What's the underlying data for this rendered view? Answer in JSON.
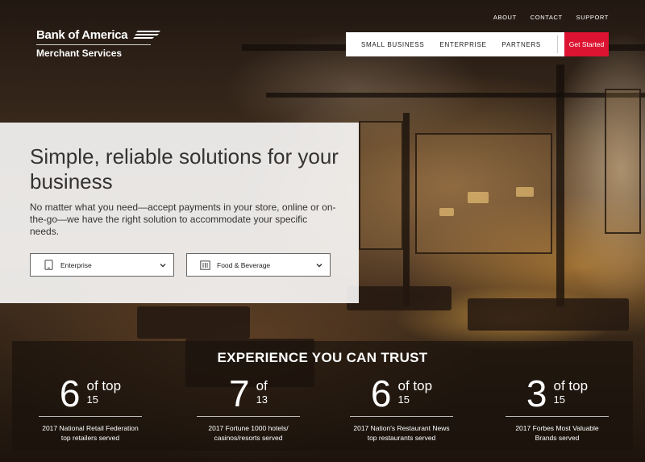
{
  "brand": {
    "name": "Bank of America",
    "subtitle": "Merchant Services"
  },
  "utility_nav": [
    "ABOUT",
    "CONTACT",
    "SUPPORT"
  ],
  "main_nav": {
    "links": [
      "SMALL BUSINESS",
      "ENTERPRISE",
      "PARTNERS"
    ],
    "search_icon": "search-icon",
    "cta": "Get Started"
  },
  "hero": {
    "title": "Simple, reliable solutions for your business",
    "description": "No matter what you need—accept payments in your store, online or on-the-go—we have the right solution to accommodate your specific needs.",
    "selects": [
      {
        "icon": "tablet-icon",
        "value": "Enterprise"
      },
      {
        "icon": "utensils-icon",
        "value": "Food & Beverage"
      }
    ]
  },
  "stats": {
    "heading": "EXPERIENCE YOU CAN TRUST",
    "items": [
      {
        "number": "6",
        "of_line": "of top",
        "of_num": "15",
        "caption": "2017 National Retail Federation top retailers served"
      },
      {
        "number": "7",
        "of_line": "of",
        "of_num": "13",
        "caption": "2017 Fortune 1000 hotels/ casinos/resorts served"
      },
      {
        "number": "6",
        "of_line": "of top",
        "of_num": "15",
        "caption": "2017 Nation's Restaurant News top restaurants served"
      },
      {
        "number": "3",
        "of_line": "of top",
        "of_num": "15",
        "caption": "2017 Forbes Most Valuable Brands served"
      }
    ]
  },
  "colors": {
    "cta_red": "#dc1431",
    "nav_bg": "#ffffff",
    "hero_card_bg": "#ffffff"
  }
}
